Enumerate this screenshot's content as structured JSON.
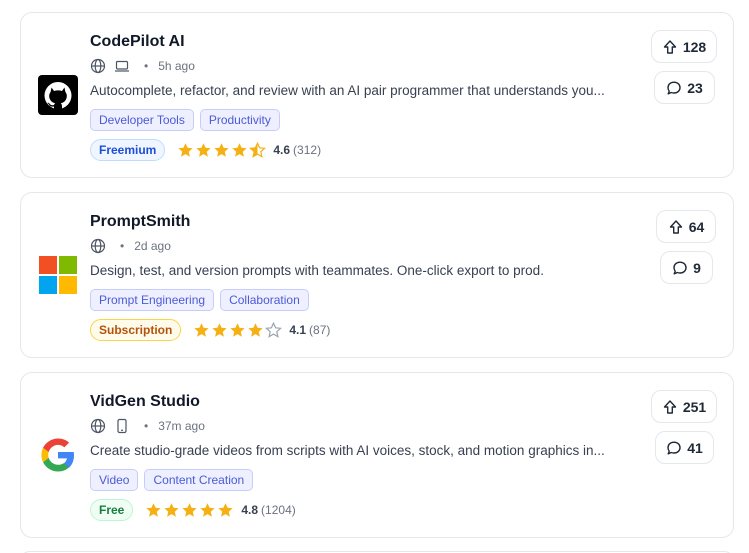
{
  "tools": [
    {
      "name": "CodePilot AI",
      "logo_icon": "github-icon",
      "platforms": [
        "web-icon",
        "desktop-icon"
      ],
      "posted": "5h ago",
      "description": "Autocomplete, refactor, and review with an AI pair programmer that understands you...",
      "tags": [
        "Developer Tools",
        "Productivity"
      ],
      "pricing": "Freemium",
      "rating_value": 4.6,
      "rating": "4.6",
      "reviews": "(312)",
      "upvotes": "128",
      "comments": "23"
    },
    {
      "name": "PromptSmith",
      "logo_icon": "microsoft-icon",
      "platforms": [
        "web-icon"
      ],
      "posted": "2d ago",
      "description": "Design, test, and version prompts with teammates. One-click export to prod.",
      "tags": [
        "Prompt Engineering",
        "Collaboration"
      ],
      "pricing": "Subscription",
      "rating_value": 4.1,
      "rating": "4.1",
      "reviews": "(87)",
      "upvotes": "64",
      "comments": "9"
    },
    {
      "name": "VidGen Studio",
      "logo_icon": "google-icon",
      "platforms": [
        "web-icon",
        "mobile-icon"
      ],
      "posted": "37m ago",
      "description": "Create studio-grade videos from scripts with AI voices, stock, and motion graphics in...",
      "tags": [
        "Video",
        "Content Creation"
      ],
      "pricing": "Free",
      "rating_value": 4.8,
      "rating": "4.8",
      "reviews": "(1204)",
      "upvotes": "251",
      "comments": "41"
    }
  ],
  "colors": {
    "star": "#f5b014",
    "star_empty": "#d1d5db",
    "tag_text": "#4b5ad6",
    "card_border": "#e5e7eb"
  }
}
